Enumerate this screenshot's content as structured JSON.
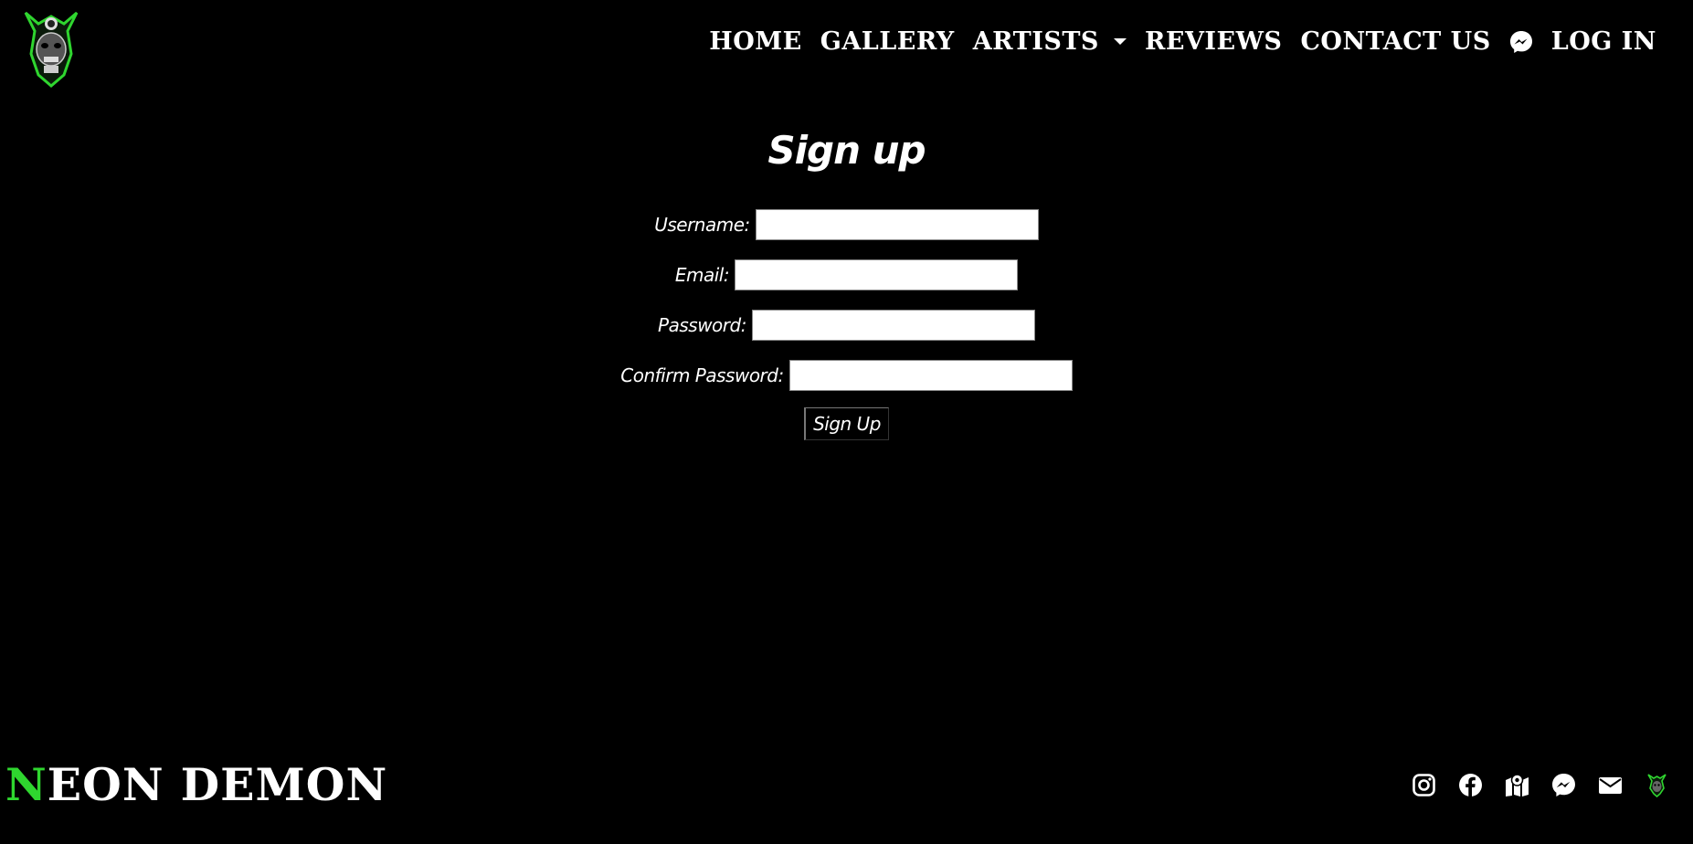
{
  "nav": {
    "home": "HOME",
    "gallery": "GALLERY",
    "artists": "ARTISTS",
    "reviews": "REVIEWS",
    "contact": "CONTACT US",
    "login": "LOG IN"
  },
  "form": {
    "title": "Sign up",
    "username_label": "Username:",
    "email_label": "Email:",
    "password_label": "Password:",
    "confirm_label": "Confirm Password:",
    "username_value": "",
    "email_value": "",
    "password_value": "",
    "confirm_value": "",
    "submit_label": "Sign Up"
  },
  "footer": {
    "brand_first": "N",
    "brand_rest": "EON DEMON"
  },
  "icons": {
    "logo": "demon-mask-logo-icon",
    "messenger_nav": "messenger-icon",
    "instagram": "instagram-icon",
    "facebook": "facebook-icon",
    "map": "map-icon",
    "messenger": "messenger-icon",
    "email": "envelope-icon",
    "mini_logo": "demon-mask-logo-icon"
  },
  "colors": {
    "background": "#000000",
    "text": "#ffffff",
    "accent_green": "#2fd62f"
  }
}
